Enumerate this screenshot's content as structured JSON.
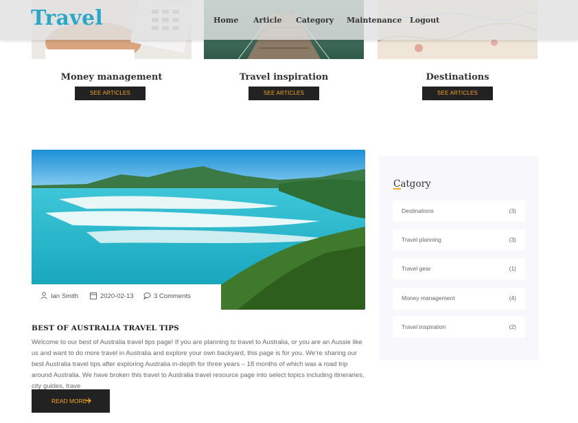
{
  "header": {
    "logo": "Travel",
    "nav": [
      "Home",
      "Article",
      "Category",
      "Maintenance",
      "Logout"
    ]
  },
  "categories": [
    {
      "title": "Money management",
      "button": "SEE ARTICLES"
    },
    {
      "title": "Travel inspiration",
      "button": "SEE ARTICLES"
    },
    {
      "title": "Destinations",
      "button": "SEE ARTICLES"
    }
  ],
  "post": {
    "author": "Ian Smith",
    "date": "2020-02-13",
    "comments": "3 Comments",
    "title": "BEST OF AUSTRALIA TRAVEL TIPS",
    "excerpt": "Welcome to our best of Australia travel tips page! If you are planning to travel to Australia, or you are an Aussie like us and want to do more travel in Australia and explore your own backyard, this page is for you. We’re sharing our best Australia travel tips after exploring Australia in-depth for three years – 18 months of which was a road trip around Australia. We have broken this travel to Australia travel resource page into select topics including itineraries, city guides, trave",
    "read_more": "READ MORE"
  },
  "sidebar": {
    "title": "Catgory",
    "items": [
      {
        "label": "Destinations",
        "count": "(3)"
      },
      {
        "label": "Travel planning",
        "count": "(3)"
      },
      {
        "label": "Travel gear",
        "count": "(1)"
      },
      {
        "label": "Money management",
        "count": "(4)"
      },
      {
        "label": "Travel inspiration",
        "count": "(2)"
      }
    ]
  },
  "colors": {
    "brand": "#2aa7c9",
    "accent": "#f5a623",
    "dark": "#222222"
  }
}
